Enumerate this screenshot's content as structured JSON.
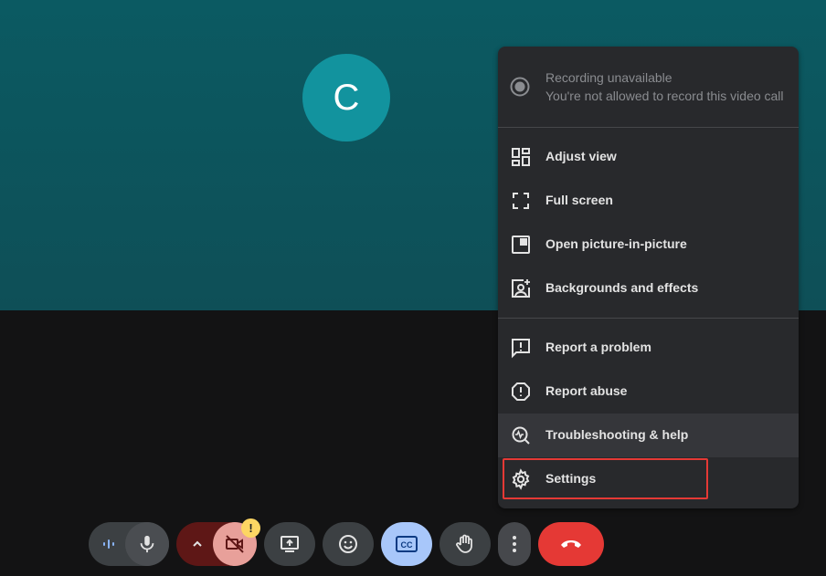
{
  "participant": {
    "initial": "C"
  },
  "menu": {
    "recording": {
      "title": "Recording unavailable",
      "subtitle": "You're not allowed to record this video call"
    },
    "items": [
      {
        "label": "Adjust view",
        "icon": "adjust-view-icon"
      },
      {
        "label": "Full screen",
        "icon": "fullscreen-icon"
      },
      {
        "label": "Open picture-in-picture",
        "icon": "picture-in-picture-icon"
      },
      {
        "label": "Backgrounds and effects",
        "icon": "backgrounds-effects-icon"
      },
      {
        "label": "Report a problem",
        "icon": "report-problem-icon"
      },
      {
        "label": "Report abuse",
        "icon": "report-abuse-icon"
      },
      {
        "label": "Troubleshooting & help",
        "icon": "troubleshooting-icon"
      },
      {
        "label": "Settings",
        "icon": "gear-icon"
      }
    ]
  },
  "controls": {
    "camera_warning": "!",
    "captions_label": "CC"
  },
  "colors": {
    "video_bg": "#0b5a62",
    "avatar_bg": "#12939e",
    "menu_bg": "#28292c",
    "end_call": "#e53935",
    "camera_off_bg": "#e8a09a",
    "captions_bg": "#a8c7fa",
    "highlight_outline": "#e53935"
  }
}
